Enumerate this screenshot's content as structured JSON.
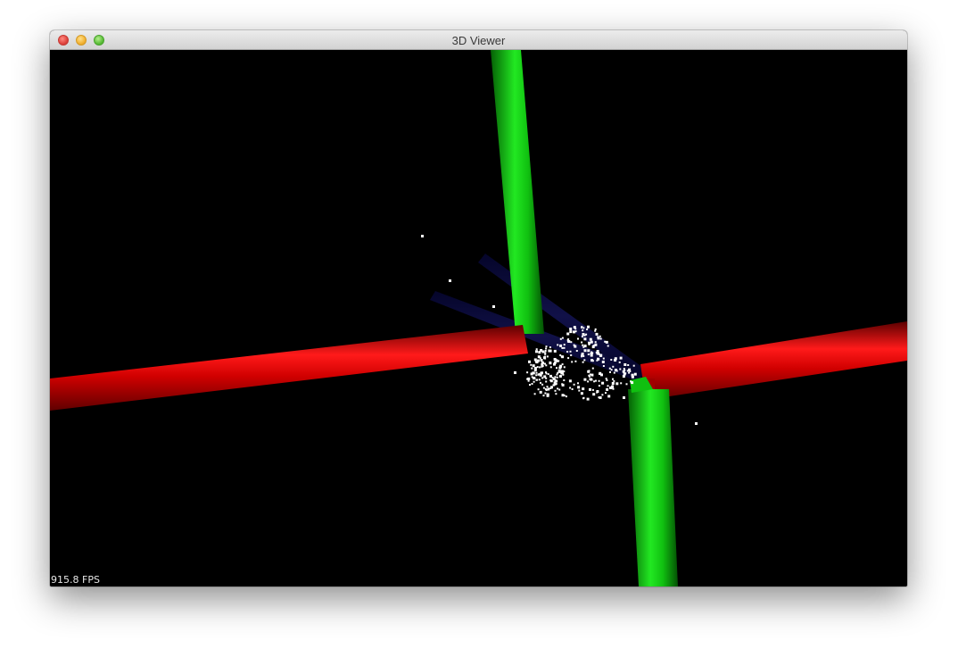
{
  "window": {
    "title": "3D Viewer"
  },
  "viewer": {
    "fps_label": "915.8 FPS",
    "axis_colors": {
      "x_axis": "#e00000",
      "y_axis": "#10d010",
      "z_axis": "#0a0a3a"
    },
    "point_color": "#ffffff",
    "background": "#000000"
  },
  "icons": {
    "close": "close-button-icon",
    "minimize": "minimize-button-icon",
    "zoom": "zoom-button-icon"
  }
}
